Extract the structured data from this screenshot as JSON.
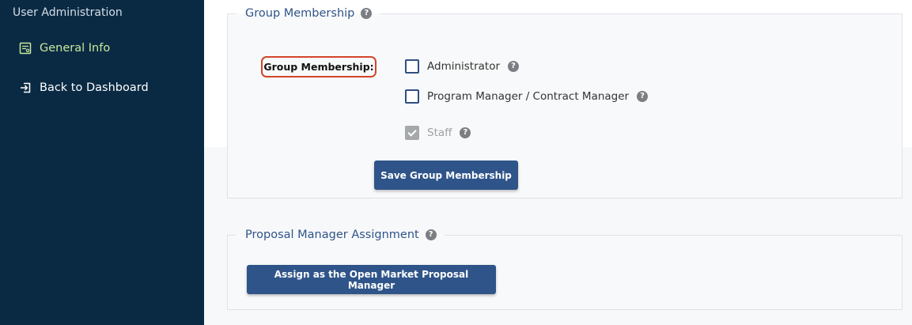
{
  "sidebar": {
    "section_title": "User Administration",
    "items": [
      {
        "label": "General Info",
        "icon": "user-details-icon",
        "active": true
      },
      {
        "label": "Back to Dashboard",
        "icon": "sign-in-icon",
        "active": false
      }
    ]
  },
  "group_membership": {
    "legend": "Group Membership",
    "field_label": "Group Membership:",
    "options": [
      {
        "label": "Administrator",
        "checked": false,
        "disabled": false
      },
      {
        "label": "Program Manager / Contract Manager",
        "checked": false,
        "disabled": false
      },
      {
        "label": "Staff",
        "checked": true,
        "disabled": true
      }
    ],
    "save_button": "Save Group Membership"
  },
  "proposal_manager": {
    "legend": "Proposal Manager Assignment",
    "assign_button": "Assign as the Open Market Proposal Manager"
  },
  "colors": {
    "sidebar_bg": "#0a2a44",
    "active_nav": "#c9e89a",
    "primary": "#2f5489",
    "highlight_border": "#d2452a"
  }
}
